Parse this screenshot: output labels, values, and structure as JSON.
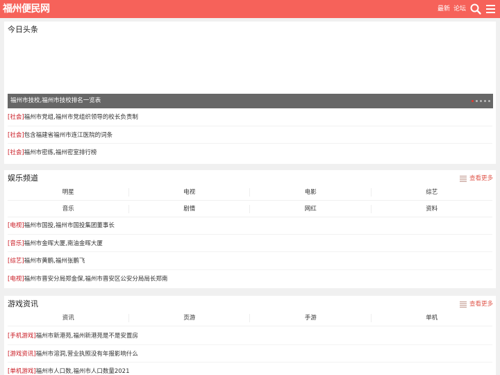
{
  "header": {
    "logo": "福州便民网",
    "nav": [
      "最新",
      "论坛"
    ],
    "icons": [
      "search-icon",
      "menu-icon"
    ],
    "bg_color": "#f6625a"
  },
  "headlines": {
    "title": "今日头条",
    "slide_caption": "福州市技校,福州市技校排名一览表",
    "slide_count": 5,
    "items": [
      {
        "tag": "[社会]",
        "text": "福州市党组,福州市党组织领导的校长负责制"
      },
      {
        "tag": "[社会]",
        "text": "包含福建省福州市连江医院的词条"
      },
      {
        "tag": "[社会]",
        "text": "福州市密练,福州密室排行榜"
      }
    ]
  },
  "entertainment": {
    "title": "娱乐频道",
    "more": "查看更多",
    "categories": [
      "明星",
      "电视",
      "电影",
      "综艺",
      "音乐",
      "剧情",
      "网红",
      "资料"
    ],
    "items": [
      {
        "tag": "[电视]",
        "text": "福州市国投,福州市国投集团董事长"
      },
      {
        "tag": "[音乐]",
        "text": "福州市金晖大厦,南油金晖大厦"
      },
      {
        "tag": "[综艺]",
        "text": "福州市黄鹏,福州张鹏飞"
      },
      {
        "tag": "[电视]",
        "text": "福州市晋安分局郑金保,福州市晋安区公安分局局长郑南"
      }
    ]
  },
  "games": {
    "title": "游戏资讯",
    "more": "查看更多",
    "categories": [
      "资讯",
      "页游",
      "手游",
      "单机"
    ],
    "items": [
      {
        "tag": "[手机游戏]",
        "text": "福州市新港苑,福州新港苑是不是安置房"
      },
      {
        "tag": "[游戏资讯]",
        "text": "福州市溶洞,营业执照没有年报影响什么"
      },
      {
        "tag": "[单机游戏]",
        "text": "福州市人口数,福州市人口数量2021"
      }
    ]
  },
  "accent_color": "#c8141d"
}
